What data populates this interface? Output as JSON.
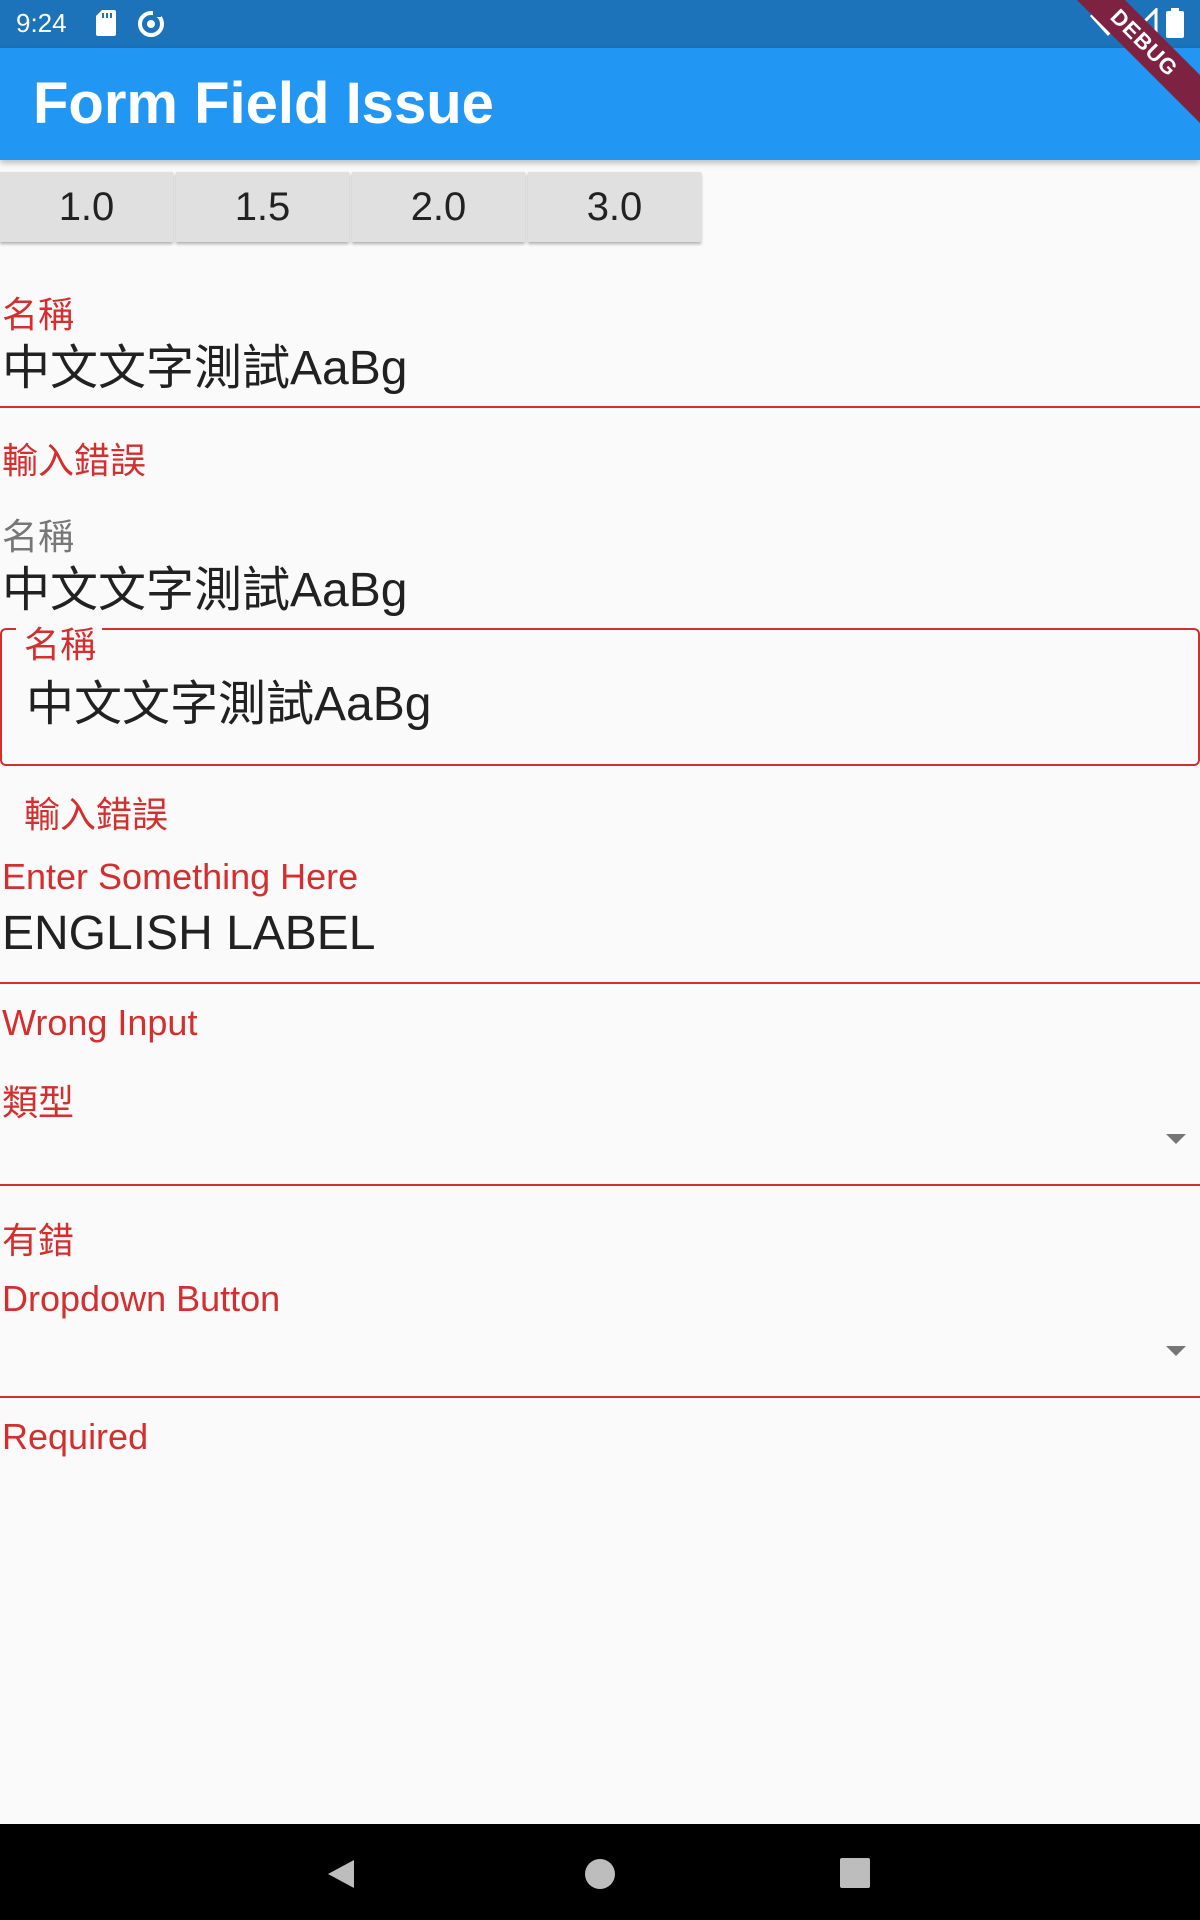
{
  "status_bar": {
    "time": "9:24",
    "icons": [
      "sd-card-icon",
      "sync-icon",
      "wifi-icon",
      "signal-icon",
      "battery-icon"
    ]
  },
  "app_bar": {
    "title": "Form Field Issue"
  },
  "debug_banner": "DEBUG",
  "scale_buttons": [
    "1.0",
    "1.5",
    "2.0",
    "3.0"
  ],
  "fields": {
    "field1": {
      "label": "名稱",
      "value": "中文文字測試AaBg",
      "error": "輸入錯誤"
    },
    "field2": {
      "label": "名稱",
      "value": "中文文字測試AaBg"
    },
    "field3": {
      "label": "名稱",
      "value": "中文文字測試AaBg",
      "error": "輸入錯誤"
    },
    "field4": {
      "label": "Enter Something Here",
      "value": "ENGLISH LABEL",
      "error": "Wrong Input"
    },
    "dropdown1": {
      "label": "類型",
      "error": "有錯"
    },
    "dropdown2": {
      "label": "Dropdown Button",
      "error": "Required"
    }
  },
  "colors": {
    "status_bar": "#1c73ba",
    "app_bar": "#2196f3",
    "error": "#d32f2f",
    "debug_banner": "#7d2240"
  },
  "nav_bar": [
    "back-icon",
    "home-icon",
    "recents-icon"
  ]
}
